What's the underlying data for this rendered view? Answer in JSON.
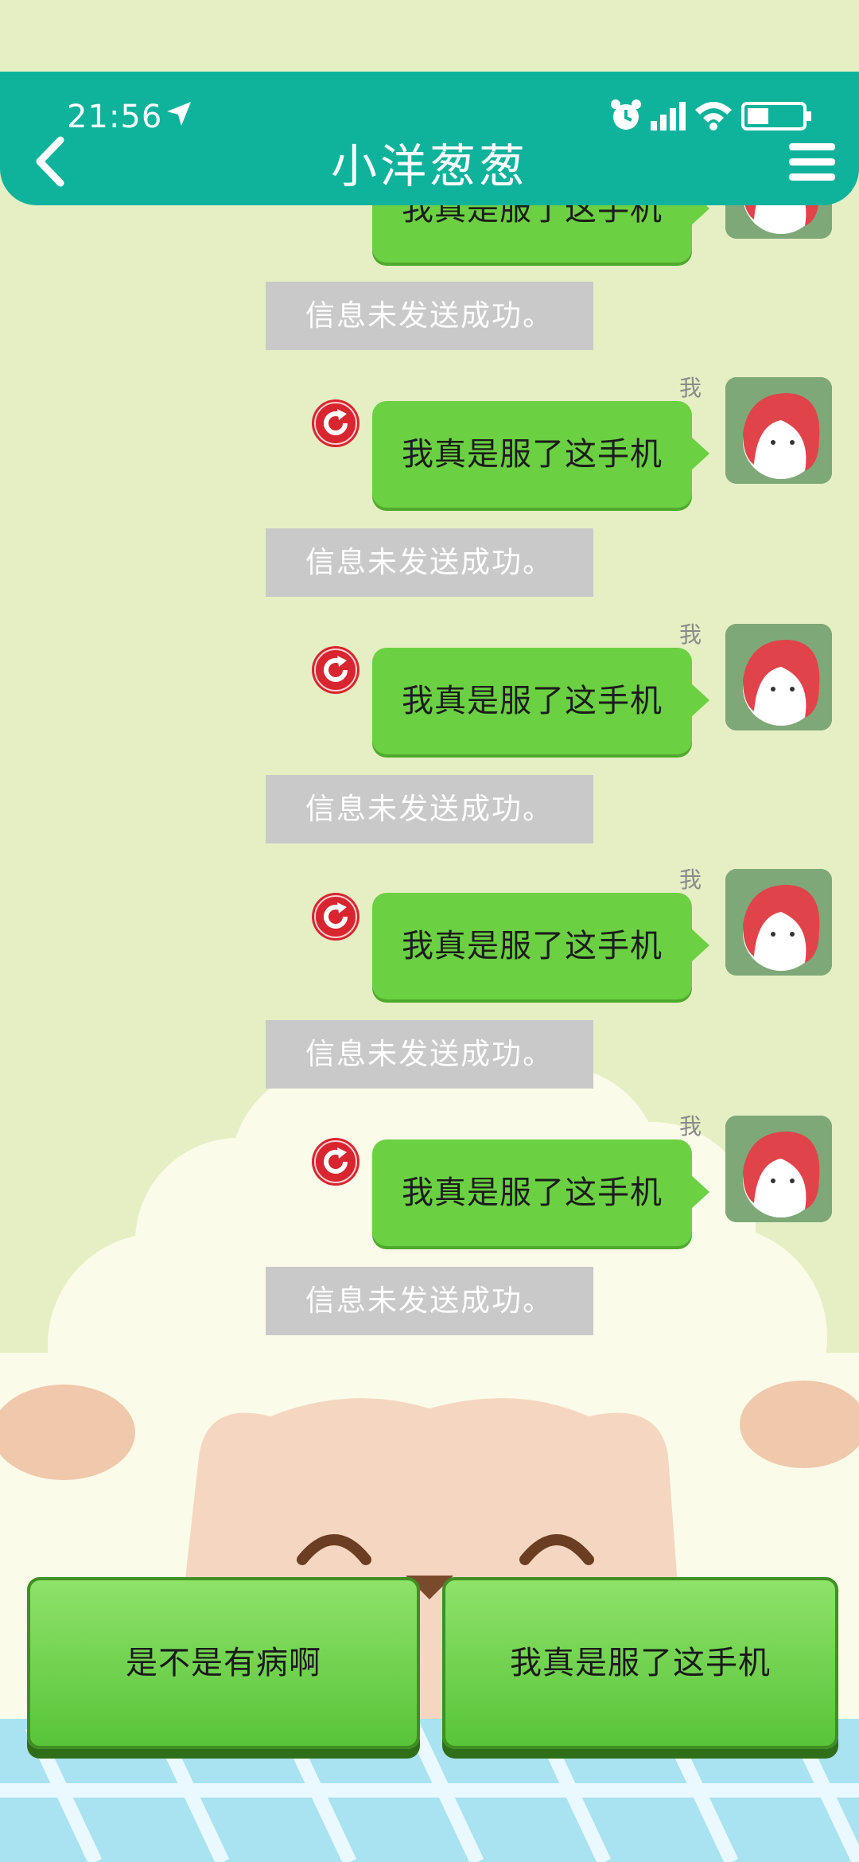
{
  "status_bar": {
    "time": "21:56"
  },
  "header": {
    "title": "小洋葱葱"
  },
  "messages": [
    {
      "text": "我真是服了这手机",
      "sender": "我",
      "note": "信息未发送成功。"
    },
    {
      "text": "我真是服了这手机",
      "sender": "我",
      "note": "信息未发送成功。"
    },
    {
      "text": "我真是服了这手机",
      "sender": "我",
      "note": "信息未发送成功。"
    },
    {
      "text": "我真是服了这手机",
      "sender": "我",
      "note": "信息未发送成功。"
    },
    {
      "text": "我真是服了这手机",
      "sender": "我",
      "note": "信息未发送成功。"
    }
  ],
  "options": [
    {
      "label": "是不是有病啊"
    },
    {
      "label": "我真是服了这手机"
    }
  ],
  "colors": {
    "header": "#0fb39c",
    "bubble": "#6bd042",
    "background": "#e6efc4",
    "note_bg": "#c9c9c9",
    "retry": "#d8252f"
  }
}
